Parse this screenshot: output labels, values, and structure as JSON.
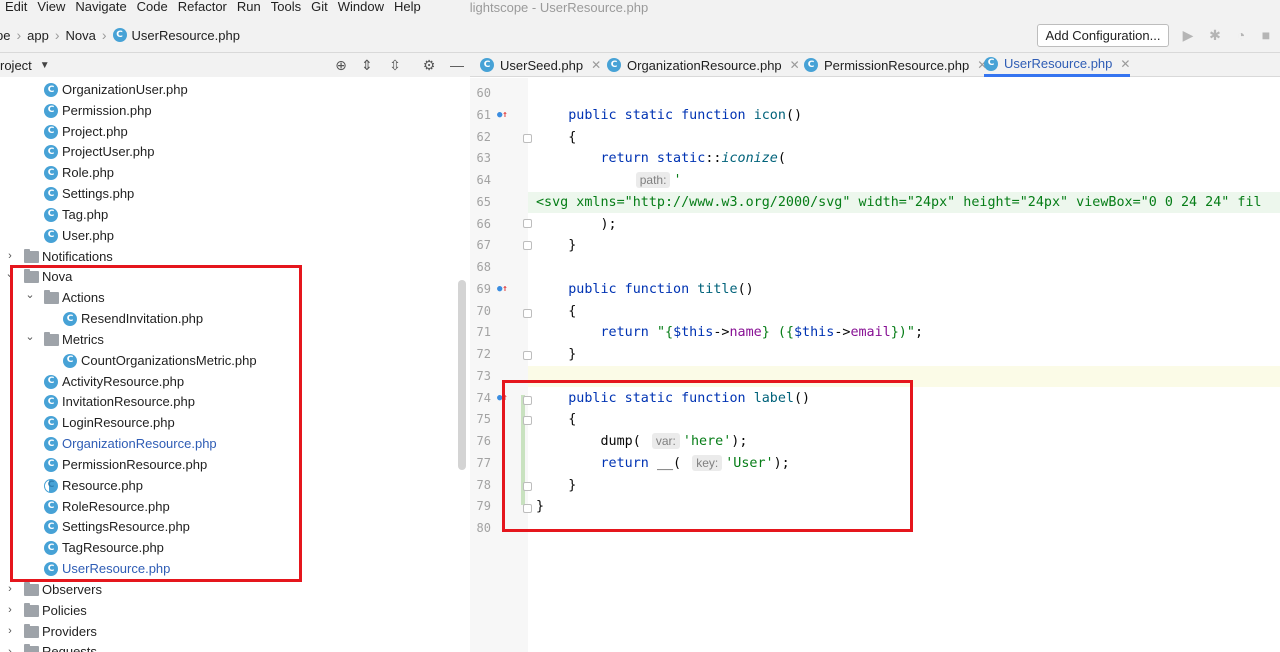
{
  "menu": {
    "items": [
      "Edit",
      "View",
      "Navigate",
      "Code",
      "Refactor",
      "Run",
      "Tools",
      "Git",
      "Window",
      "Help"
    ],
    "window_title": "lightscope - UserResource.php"
  },
  "breadcrumb": {
    "items": [
      "pe",
      "app",
      "Nova",
      "UserResource.php"
    ]
  },
  "toolbar": {
    "add_config_label": "Add Configuration..."
  },
  "project_panel": {
    "title": "roject",
    "tree": [
      {
        "label": "OrganizationUser.php",
        "kind": "file",
        "depth": 2
      },
      {
        "label": "Permission.php",
        "kind": "file",
        "depth": 2
      },
      {
        "label": "Project.php",
        "kind": "file",
        "depth": 2
      },
      {
        "label": "ProjectUser.php",
        "kind": "file",
        "depth": 2
      },
      {
        "label": "Role.php",
        "kind": "file",
        "depth": 2
      },
      {
        "label": "Settings.php",
        "kind": "file",
        "depth": 2
      },
      {
        "label": "Tag.php",
        "kind": "file",
        "depth": 2
      },
      {
        "label": "User.php",
        "kind": "file",
        "depth": 2
      },
      {
        "label": "Notifications",
        "kind": "folder",
        "depth": 1,
        "expanded": false
      },
      {
        "label": "Nova",
        "kind": "folder",
        "depth": 1,
        "expanded": true
      },
      {
        "label": "Actions",
        "kind": "folder",
        "depth": 2,
        "expanded": true
      },
      {
        "label": "ResendInvitation.php",
        "kind": "file",
        "depth": 3
      },
      {
        "label": "Metrics",
        "kind": "folder",
        "depth": 2,
        "expanded": true
      },
      {
        "label": "CountOrganizationsMetric.php",
        "kind": "file",
        "depth": 3
      },
      {
        "label": "ActivityResource.php",
        "kind": "file",
        "depth": 2
      },
      {
        "label": "InvitationResource.php",
        "kind": "file",
        "depth": 2
      },
      {
        "label": "LoginResource.php",
        "kind": "file",
        "depth": 2
      },
      {
        "label": "OrganizationResource.php",
        "kind": "file",
        "depth": 2,
        "blue": true
      },
      {
        "label": "PermissionResource.php",
        "kind": "file",
        "depth": 2
      },
      {
        "label": "Resource.php",
        "kind": "file",
        "depth": 2,
        "partial": true
      },
      {
        "label": "RoleResource.php",
        "kind": "file",
        "depth": 2
      },
      {
        "label": "SettingsResource.php",
        "kind": "file",
        "depth": 2
      },
      {
        "label": "TagResource.php",
        "kind": "file",
        "depth": 2
      },
      {
        "label": "UserResource.php",
        "kind": "file",
        "depth": 2,
        "blue": true
      },
      {
        "label": "Observers",
        "kind": "folder",
        "depth": 1,
        "expanded": false
      },
      {
        "label": "Policies",
        "kind": "folder",
        "depth": 1,
        "expanded": false
      },
      {
        "label": "Providers",
        "kind": "folder",
        "depth": 1,
        "expanded": false
      },
      {
        "label": "Requests",
        "kind": "folder",
        "depth": 1,
        "expanded": false
      }
    ]
  },
  "tabs": [
    {
      "label": "UserSeed.php",
      "active": false
    },
    {
      "label": "OrganizationResource.php",
      "active": false
    },
    {
      "label": "PermissionResource.php",
      "active": false
    },
    {
      "label": "UserResource.php",
      "active": true
    }
  ],
  "editor": {
    "lines": [
      {
        "n": "60",
        "tokens": []
      },
      {
        "n": "61",
        "tokens": [
          [
            "",
            "    "
          ],
          [
            "kw",
            "public static function "
          ],
          [
            "fn",
            "icon"
          ],
          [
            "",
            "()"
          ]
        ],
        "marker": true
      },
      {
        "n": "62",
        "tokens": [
          [
            "",
            "    {"
          ]
        ]
      },
      {
        "n": "63",
        "tokens": [
          [
            "",
            "        "
          ],
          [
            "kw",
            "return static"
          ],
          [
            "",
            "::"
          ],
          [
            "it",
            "iconize"
          ],
          [
            "",
            "("
          ]
        ]
      },
      {
        "n": "64",
        "tokens": [
          [
            "",
            "            "
          ],
          [
            "hint",
            "path:"
          ],
          [
            "str",
            "'"
          ]
        ]
      },
      {
        "n": "65",
        "tokens": [
          [
            "str",
            "<svg xmlns=\"http://www.w3.org/2000/svg\" width=\"24px\" height=\"24px\" viewBox=\"0 0 24 24\" fil"
          ]
        ],
        "long": true,
        "no_indent": true
      },
      {
        "n": "66",
        "tokens": [
          [
            "",
            "        );"
          ]
        ]
      },
      {
        "n": "67",
        "tokens": [
          [
            "",
            "    }"
          ]
        ]
      },
      {
        "n": "68",
        "tokens": []
      },
      {
        "n": "69",
        "tokens": [
          [
            "",
            "    "
          ],
          [
            "kw",
            "public function "
          ],
          [
            "fn",
            "title"
          ],
          [
            "",
            "()"
          ]
        ],
        "marker": true
      },
      {
        "n": "70",
        "tokens": [
          [
            "",
            "    {"
          ]
        ]
      },
      {
        "n": "71",
        "tokens": [
          [
            "",
            "        "
          ],
          [
            "kw",
            "return "
          ],
          [
            "str",
            "\"{"
          ],
          [
            "kw",
            "$this"
          ],
          [
            "",
            "->"
          ],
          [
            "mem",
            "name"
          ],
          [
            "str",
            "} ({"
          ],
          [
            "kw",
            "$this"
          ],
          [
            "",
            "->"
          ],
          [
            "mem",
            "email"
          ],
          [
            "str",
            "})\""
          ],
          [
            "",
            ";"
          ]
        ]
      },
      {
        "n": "72",
        "tokens": [
          [
            "",
            "    }"
          ]
        ]
      },
      {
        "n": "73",
        "tokens": [],
        "current": true
      },
      {
        "n": "74",
        "tokens": [
          [
            "",
            "    "
          ],
          [
            "kw",
            "public static function "
          ],
          [
            "fn",
            "label"
          ],
          [
            "",
            "()"
          ]
        ],
        "marker": true
      },
      {
        "n": "75",
        "tokens": [
          [
            "",
            "    {"
          ]
        ]
      },
      {
        "n": "76",
        "tokens": [
          [
            "",
            "        dump( "
          ],
          [
            "hint",
            "var:"
          ],
          [
            "str",
            "'here'"
          ],
          [
            "",
            ");"
          ]
        ]
      },
      {
        "n": "77",
        "tokens": [
          [
            "",
            "        "
          ],
          [
            "kw",
            "return "
          ],
          [
            "",
            "__( "
          ],
          [
            "hint",
            "key:"
          ],
          [
            "str",
            "'User'"
          ],
          [
            "",
            ");"
          ]
        ]
      },
      {
        "n": "78",
        "tokens": [
          [
            "",
            "    }"
          ]
        ]
      },
      {
        "n": "79",
        "tokens": [
          [
            "",
            "}"
          ]
        ]
      },
      {
        "n": "80",
        "tokens": []
      }
    ]
  }
}
